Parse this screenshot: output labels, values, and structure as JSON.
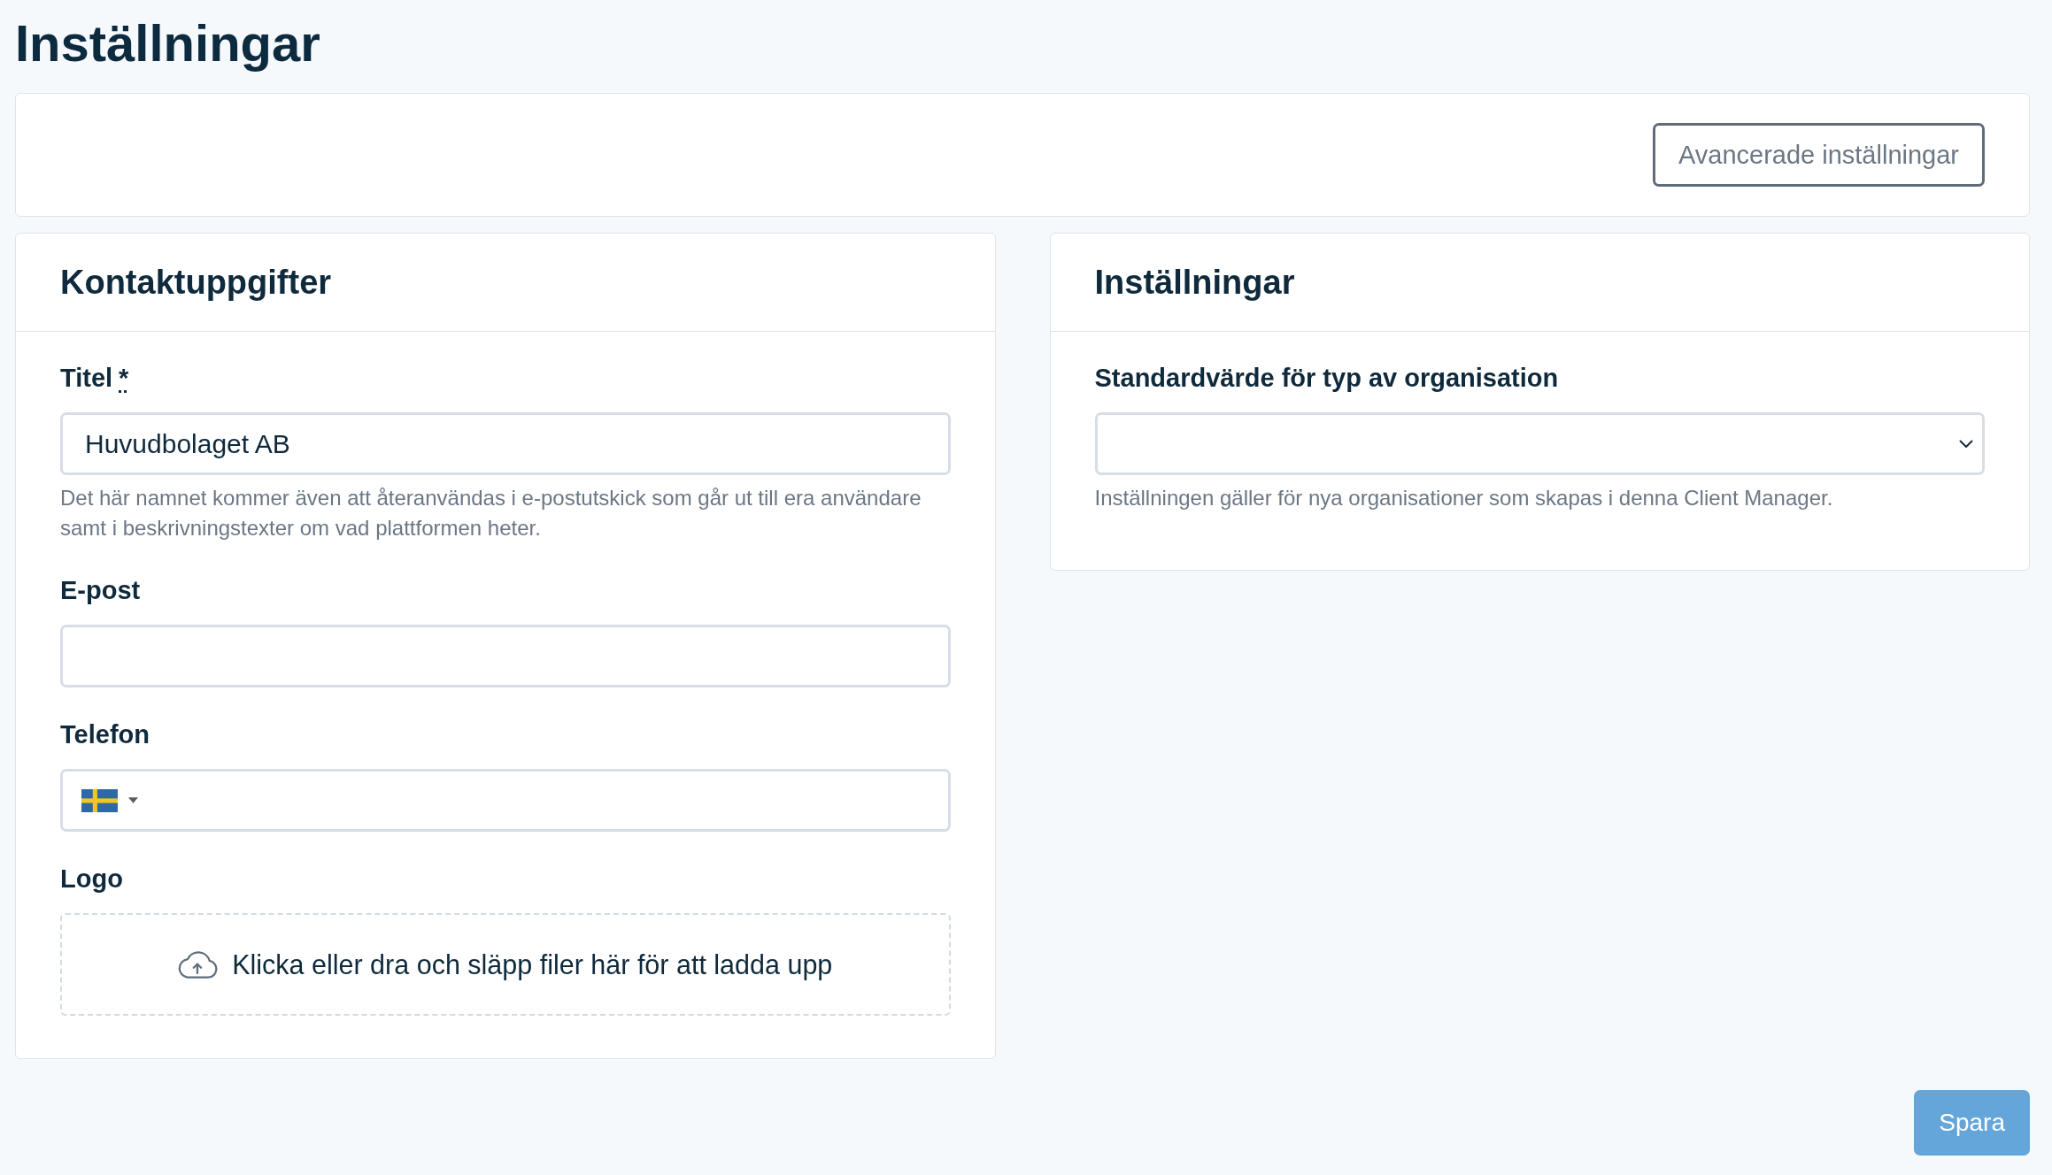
{
  "page": {
    "title": "Inställningar"
  },
  "toolbar": {
    "button": "Avancerade inställningar"
  },
  "panels": [
    {
      "title": "Kontaktuppgifter",
      "fields": [
        {
          "kind": "text",
          "label": "Titel",
          "required_mark": "*",
          "value": "Huvudbolaget AB",
          "help": "Det här namnet kommer även att återanvändas i e-postutskick som går ut till era användare samt i beskrivningstexter om vad plattformen heter."
        },
        {
          "kind": "text",
          "label": "E-post"
        },
        {
          "kind": "phone",
          "label": "Telefon"
        },
        {
          "kind": "upload",
          "label": "Logo",
          "hint": "Klicka eller dra och släpp filer här för att ladda upp"
        }
      ]
    },
    {
      "title": "Inställningar",
      "fields": [
        {
          "kind": "select",
          "label": "Standardvärde för typ av organisation",
          "help": "Inställningen gäller för nya organisationer som skapas i denna Client Manager."
        }
      ]
    }
  ],
  "footer": {
    "button": "Spara"
  }
}
